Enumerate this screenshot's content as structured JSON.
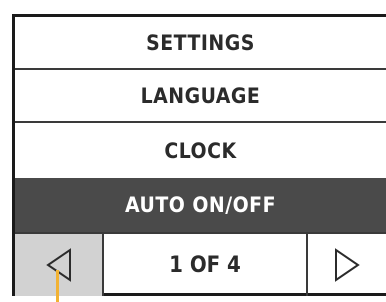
{
  "menu": {
    "title": "SETTINGS",
    "items": [
      {
        "label": "LANGUAGE"
      },
      {
        "label": "CLOCK"
      },
      {
        "label": "AUTO ON/OFF",
        "selected": true
      }
    ]
  },
  "pagination": {
    "current_label": "1 OF 4",
    "prev_icon": "triangle-left-icon",
    "next_icon": "triangle-right-icon"
  },
  "colors": {
    "selected_bg": "#4a4a4a",
    "pressed_bg": "#d2d2d2",
    "cursor": "#f2b233"
  }
}
